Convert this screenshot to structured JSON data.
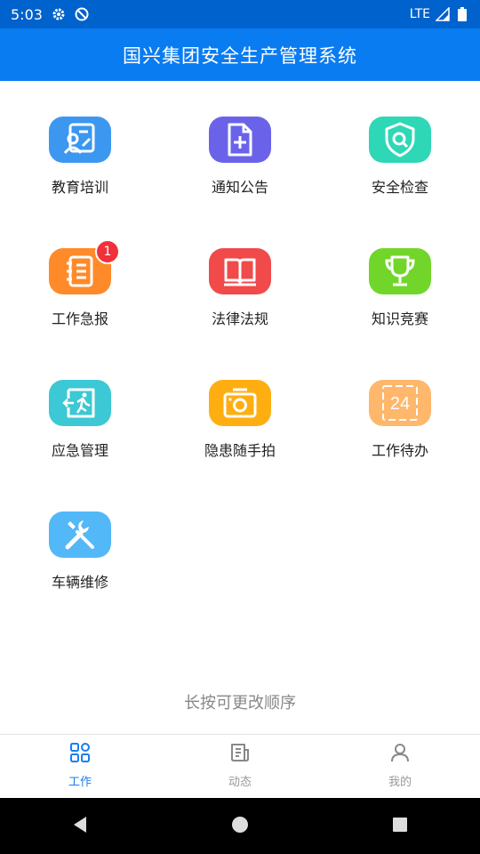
{
  "status_bar": {
    "time": "5:03",
    "network": "LTE"
  },
  "header": {
    "title": "国兴集团安全生产管理系统"
  },
  "tiles": [
    {
      "label": "教育培训",
      "color": "#3b97f0",
      "icon": "training-icon"
    },
    {
      "label": "通知公告",
      "color": "#6a63ea",
      "icon": "document-add-icon"
    },
    {
      "label": "安全检查",
      "color": "#2ed7b6",
      "icon": "shield-search-icon"
    },
    {
      "label": "工作急报",
      "color": "#ff8a2a",
      "icon": "notebook-icon",
      "badge": "1"
    },
    {
      "label": "法律法规",
      "color": "#f04a4a",
      "icon": "book-icon"
    },
    {
      "label": "知识竞赛",
      "color": "#72d62a",
      "icon": "trophy-icon"
    },
    {
      "label": "应急管理",
      "color": "#3cc8d4",
      "icon": "emergency-exit-icon"
    },
    {
      "label": "隐患随手拍",
      "color": "#ffae12",
      "icon": "camera-icon"
    },
    {
      "label": "工作待办",
      "color": "#ffb76c",
      "icon": "calendar-24-icon",
      "icon_text": "24"
    },
    {
      "label": "车辆维修",
      "color": "#52b8f8",
      "icon": "wrench-screwdriver-icon"
    }
  ],
  "hint": "长按可更改顺序",
  "tabs": [
    {
      "label": "工作",
      "icon": "grid-icon",
      "active": true
    },
    {
      "label": "动态",
      "icon": "news-icon",
      "active": false
    },
    {
      "label": "我的",
      "icon": "user-icon",
      "active": false
    }
  ]
}
